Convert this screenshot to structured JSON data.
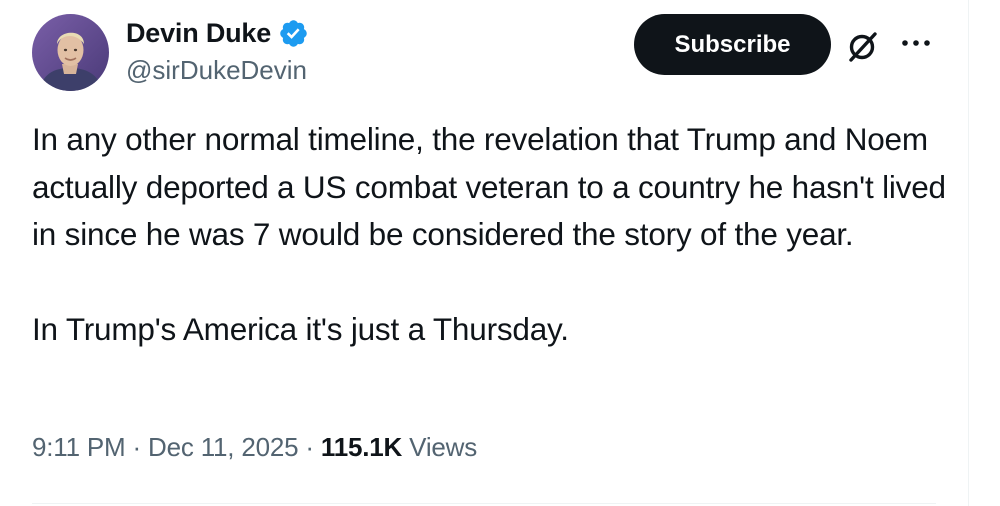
{
  "author": {
    "display_name": "Devin Duke",
    "handle": "@sirDukeDevin",
    "verified": true,
    "verified_color": "#1d9bf0"
  },
  "actions": {
    "subscribe_label": "Subscribe",
    "grok_icon": "slashed-circle-icon",
    "more_icon": "more-icon"
  },
  "post": {
    "paragraphs": [
      "In any other normal timeline, the revelation that Trump and Noem actually deported a US combat veteran to a country he hasn't lived in since he was 7 would be considered the story of the year.",
      "In Trump's America it's just a Thursday."
    ]
  },
  "meta": {
    "time": "9:11 PM",
    "separator": "·",
    "date": "Dec 11, 2025",
    "views_count": "115.1K",
    "views_label": "Views"
  },
  "colors": {
    "text_primary": "#0f1419",
    "text_secondary": "#536471",
    "button_bg": "#0f1419",
    "button_text": "#ffffff",
    "divider": "#eff3f4"
  }
}
